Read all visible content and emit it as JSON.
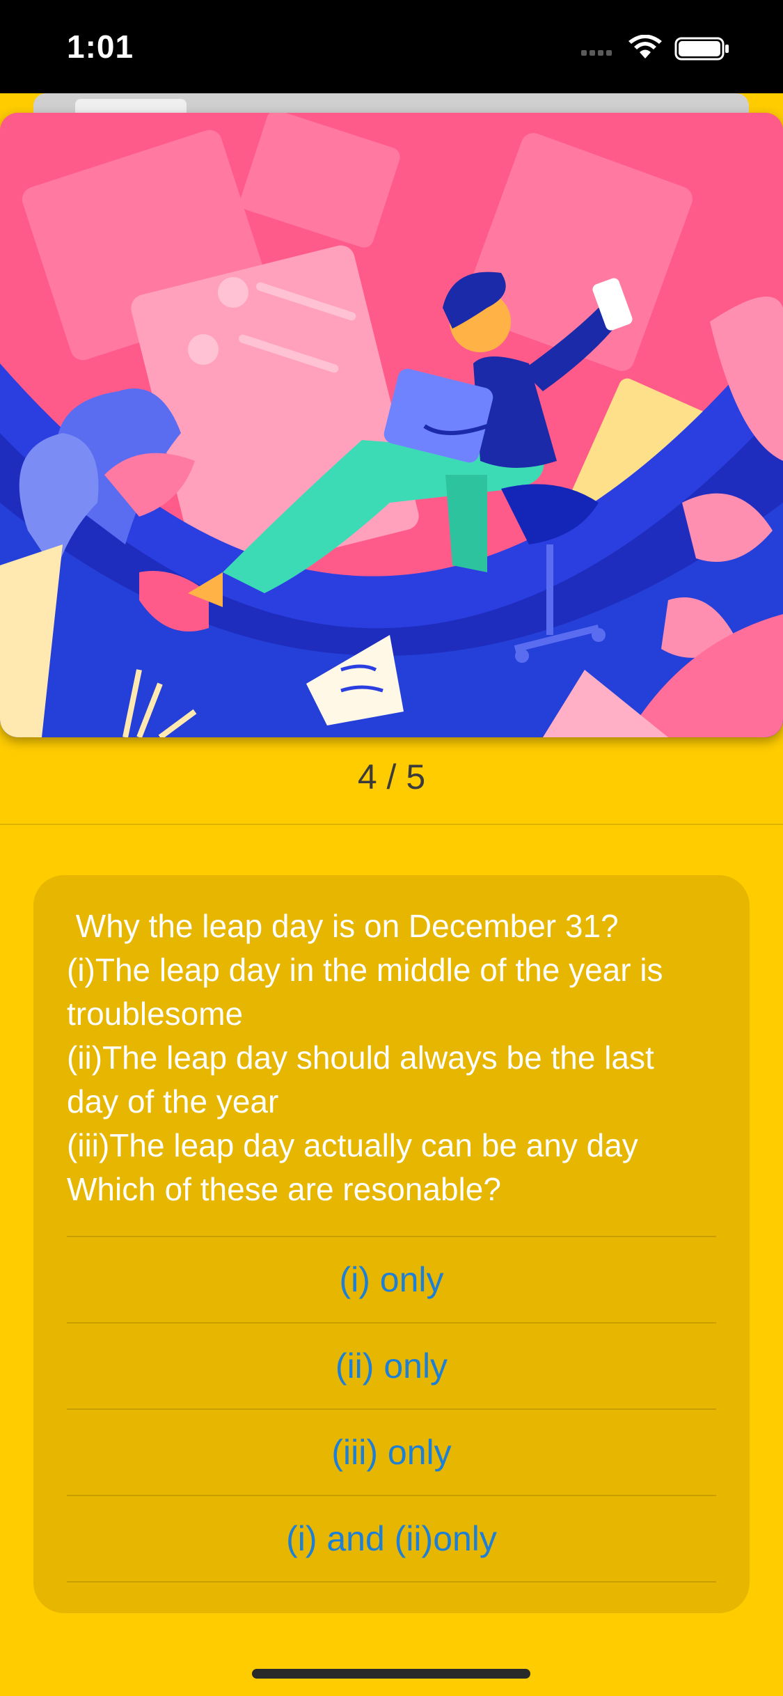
{
  "status_bar": {
    "time": "1:01",
    "icons": [
      "signal-icon",
      "wifi-icon",
      "battery-icon"
    ]
  },
  "hero": {
    "image_name": "illustration-person-on-office-chair",
    "colors": {
      "pink": "#ff5b8a",
      "blue": "#2b3fe0",
      "mint": "#3ddbb5",
      "yellow": "#ffd54a"
    }
  },
  "progress": {
    "label": "4 / 5",
    "current": 4,
    "total": 5
  },
  "question": {
    "lines": [
      " Why the leap day is on December 31?",
      "(i)The leap day in the middle of the year is",
      "troublesome",
      "(ii)The leap day should always be the last",
      "day of the year",
      "(iii)The leap day actually can be any day",
      "Which of these are resonable?"
    ]
  },
  "answers": [
    {
      "label": "(i) only"
    },
    {
      "label": "(ii) only"
    },
    {
      "label": "(iii) only"
    },
    {
      "label": "(i) and (ii)only"
    }
  ],
  "colors": {
    "background": "#ffcc00",
    "card": "#e6b600",
    "answer_text": "#1d7fd6"
  }
}
